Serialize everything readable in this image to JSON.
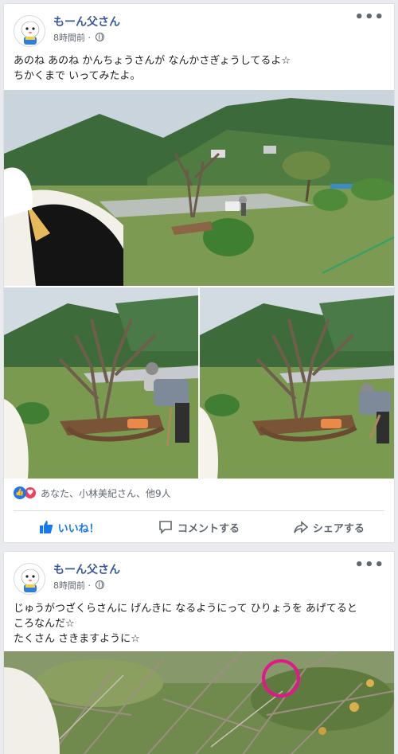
{
  "posts": [
    {
      "author": "もーん父さん",
      "time": "8時間前 · ",
      "text_lines": [
        "あのね あのね かんちょうさんが なんかさぎょうしてるよ☆",
        "ちかくまで いってみたよ。"
      ],
      "reactions": {
        "summary": "あなた、小林美紀さん、他9人"
      },
      "actions": {
        "like": "いいね！",
        "comment": "コメントする",
        "share": "シェアする"
      }
    },
    {
      "author": "もーん父さん",
      "time": "8時間前 · ",
      "text_lines": [
        "じゅうがつざくらさんに げんきに なるようにって ひりょうを あげてると",
        "ころなんだ☆",
        "たくさん さきますように☆"
      ]
    }
  ],
  "colors": {
    "link": "#385898",
    "like": "#1877f2",
    "love": "#f33e58",
    "marker": "#e0188a"
  },
  "icons": {
    "more": "more-dots-icon",
    "privacy": "globe-icon",
    "like": "thumbs-up-icon",
    "comment": "comment-bubble-icon",
    "share": "share-arrow-icon"
  }
}
